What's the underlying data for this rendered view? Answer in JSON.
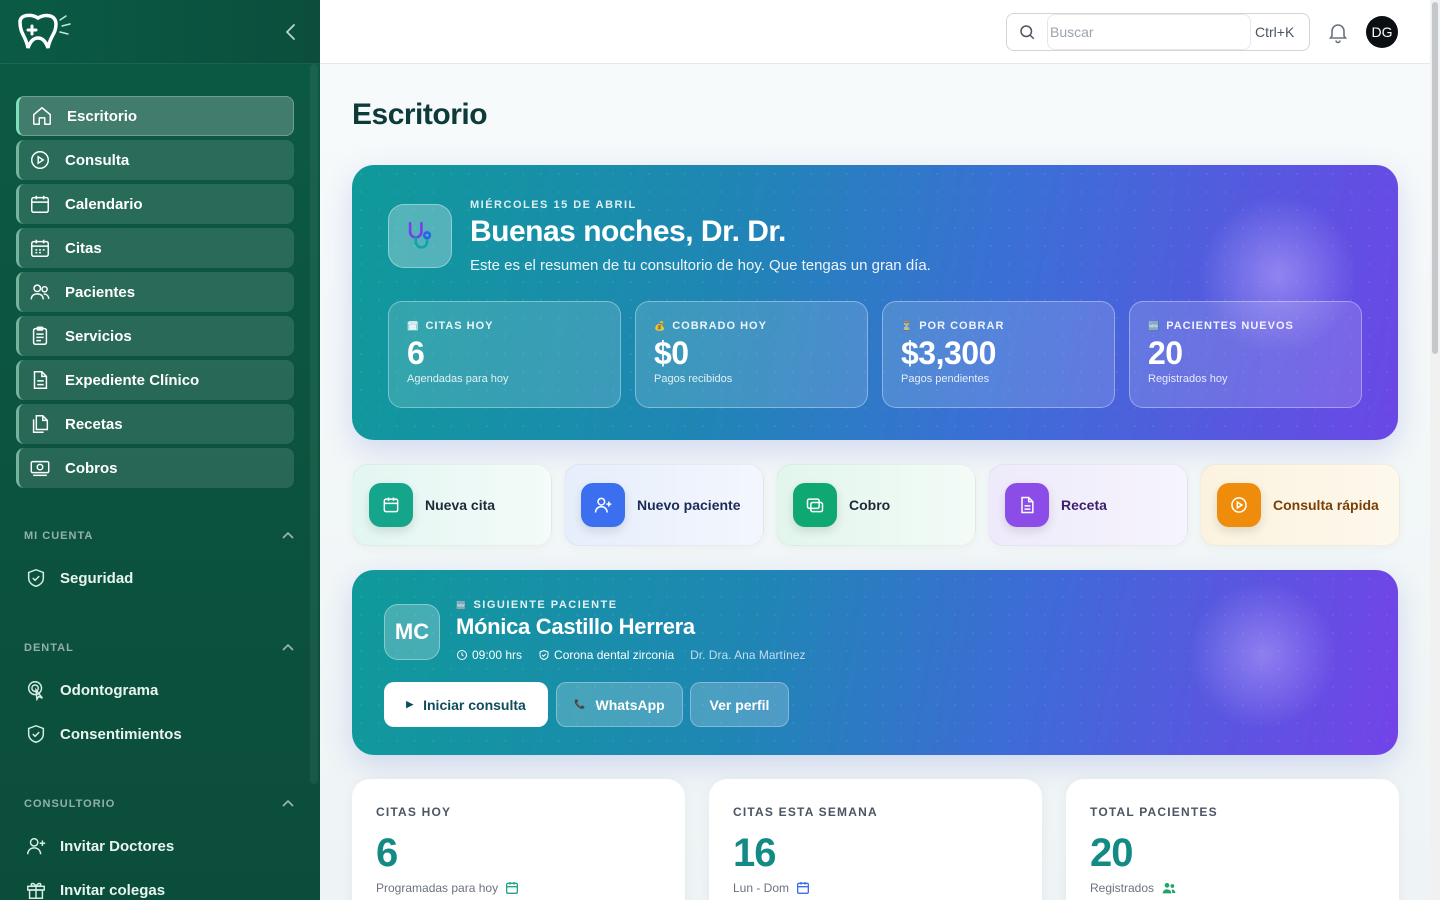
{
  "sidebar": {
    "nav": [
      {
        "label": "Escritorio",
        "icon": "home-icon",
        "active": true
      },
      {
        "label": "Consulta",
        "icon": "play-circle-icon"
      },
      {
        "label": "Calendario",
        "icon": "calendar-icon"
      },
      {
        "label": "Citas",
        "icon": "calendar-grid-icon"
      },
      {
        "label": "Pacientes",
        "icon": "users-icon"
      },
      {
        "label": "Servicios",
        "icon": "clipboard-icon"
      },
      {
        "label": "Expediente Clínico",
        "icon": "file-icon"
      },
      {
        "label": "Recetas",
        "icon": "files-icon"
      },
      {
        "label": "Cobros",
        "icon": "money-icon"
      }
    ],
    "sections": [
      {
        "title": "MI CUENTA",
        "items": [
          {
            "label": "Seguridad",
            "icon": "shield-icon"
          }
        ]
      },
      {
        "title": "DENTAL",
        "items": [
          {
            "label": "Odontograma",
            "icon": "pointer-icon"
          },
          {
            "label": "Consentimientos",
            "icon": "shield-check-icon"
          }
        ]
      },
      {
        "title": "CONSULTORIO",
        "items": [
          {
            "label": "Invitar Doctores",
            "icon": "user-plus-icon"
          },
          {
            "label": "Invitar colegas",
            "icon": "gift-icon"
          }
        ]
      }
    ]
  },
  "topbar": {
    "search_placeholder": "Buscar",
    "shortcut": "Ctrl+K",
    "avatar_initials": "DG"
  },
  "page": {
    "title": "Escritorio"
  },
  "hero": {
    "date": "MIÉRCOLES 15 DE ABRIL",
    "greeting": "Buenas noches, Dr. Dr.",
    "subtitle": "Este es el resumen de tu consultorio de hoy. Que tengas un gran día.",
    "stats": [
      {
        "emoji": "🗓",
        "label": "CITAS HOY",
        "value": "6",
        "sub": "Agendadas para hoy"
      },
      {
        "emoji": "💰",
        "label": "COBRADO HOY",
        "value": "$0",
        "sub": "Pagos recibidos"
      },
      {
        "emoji": "⏳",
        "label": "POR COBRAR",
        "value": "$3,300",
        "sub": "Pagos pendientes"
      },
      {
        "emoji": "🆕",
        "label": "PACIENTES NUEVOS",
        "value": "20",
        "sub": "Registrados hoy"
      }
    ]
  },
  "quick_actions": [
    {
      "label": "Nueva cita",
      "icon": "calendar-icon",
      "color": "#14a58a",
      "text_color": "#1f2937"
    },
    {
      "label": "Nuevo paciente",
      "icon": "user-plus-icon",
      "color": "#3b6ff0",
      "text_color": "#1e2a55"
    },
    {
      "label": "Cobro",
      "icon": "wallet-icon",
      "color": "#0fa873",
      "text_color": "#1f2937"
    },
    {
      "label": "Receta",
      "icon": "document-icon",
      "color": "#8b4ce8",
      "text_color": "#3b1f6b"
    },
    {
      "label": "Consulta rápida",
      "icon": "play-circle-icon",
      "color": "#f08c0c",
      "text_color": "#7a3f06"
    }
  ],
  "next_patient": {
    "label": "SIGUIENTE PACIENTE",
    "initials": "MC",
    "name": "Mónica Castillo Herrera",
    "time": "09:00 hrs",
    "service": "Corona dental zirconia",
    "doctor": "Dr. Dra. Ana Martínez",
    "actions": {
      "start": "Iniciar consulta",
      "whatsapp": "WhatsApp",
      "profile": "Ver perfil"
    }
  },
  "cards": [
    {
      "label": "CITAS HOY",
      "value": "6",
      "sub": "Programadas para hoy",
      "icon": "calendar-icon"
    },
    {
      "label": "CITAS ESTA SEMANA",
      "value": "16",
      "sub": "Lun - Dom",
      "icon": "calendar-icon"
    },
    {
      "label": "TOTAL PACIENTES",
      "value": "20",
      "sub": "Registrados",
      "icon": "users-icon"
    }
  ]
}
